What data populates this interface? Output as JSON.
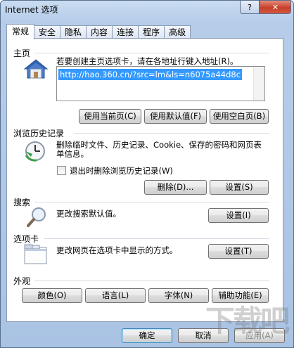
{
  "window": {
    "title": "Internet 选项",
    "help_label": "?",
    "close_label": "✕"
  },
  "tabs": [
    "常规",
    "安全",
    "隐私",
    "内容",
    "连接",
    "程序",
    "高级"
  ],
  "home": {
    "title": "主页",
    "desc": "若要创建主页选项卡，请在各地址行键入地址(R)。",
    "url": "http://hao.360.cn/?src=lm&ls=n6075a44d8c",
    "buttons": [
      "使用当前页(C)",
      "使用默认值(F)",
      "使用空白页(B)"
    ]
  },
  "history": {
    "title": "浏览历史记录",
    "desc": "删除临时文件、历史记录、Cookie、保存的密码和网页表单信息。",
    "checkbox_label": "退出时删除浏览历史记录(W)",
    "delete_label": "删除(D)...",
    "settings_label": "设置(S)"
  },
  "search": {
    "title": "搜索",
    "desc": "更改搜索默认值。",
    "settings_label": "设置(I)"
  },
  "tabsection": {
    "title": "选项卡",
    "desc": "更改网页在选项卡中显示的方式。",
    "settings_label": "设置(T)"
  },
  "appearance": {
    "title": "外观",
    "buttons": [
      "颜色(O)",
      "语言(L)",
      "字体(N)",
      "辅助功能(E)"
    ]
  },
  "footer": {
    "ok": "确定",
    "cancel": "取消",
    "apply": "应用(A)"
  },
  "watermark": "下载吧"
}
